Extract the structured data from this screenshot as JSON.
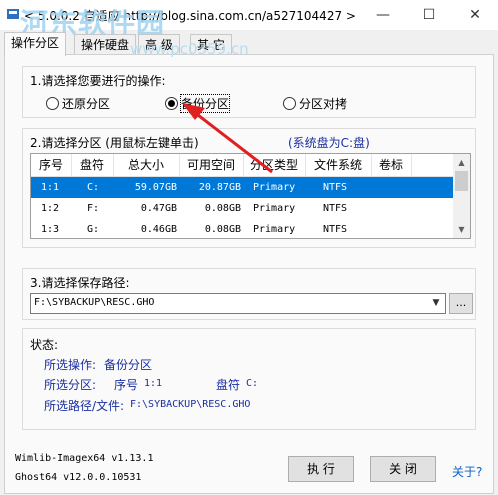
{
  "window": {
    "title": "< 5.0.0.2 自适应 http://blog.sina.com.cn/a527104427 >",
    "minimize_glyph": "—",
    "maximize_glyph": "☐",
    "close_glyph": "✕"
  },
  "watermark": {
    "main": "河东软件园",
    "url": "www.pc0359.cn"
  },
  "tabs": [
    "操作分区",
    "操作硬盘",
    "高 级",
    "其 它"
  ],
  "operation": {
    "label": "1.请选择您要进行的操作:",
    "options": [
      "还原分区",
      "备份分区",
      "分区对拷"
    ],
    "selected": "备份分区"
  },
  "partition": {
    "label": "2.请选择分区 (用鼠标左键单击)",
    "system_disk": "(系统盘为C:盘)",
    "columns": [
      "序号",
      "盘符",
      "总大小",
      "可用空间",
      "分区类型",
      "文件系统",
      "卷标"
    ],
    "rows": [
      {
        "no": "1:1",
        "drive": "C:",
        "total": "59.07GB",
        "free": "20.87GB",
        "type": "Primary",
        "fs": "NTFS",
        "label": ""
      },
      {
        "no": "1:2",
        "drive": "F:",
        "total": "0.47GB",
        "free": "0.08GB",
        "type": "Primary",
        "fs": "NTFS",
        "label": ""
      },
      {
        "no": "1:3",
        "drive": "G:",
        "total": "0.46GB",
        "free": "0.08GB",
        "type": "Primary",
        "fs": "NTFS",
        "label": ""
      }
    ],
    "selected_row": 0
  },
  "save_path": {
    "label": "3.请选择保存路径:",
    "value": "F:\\SYBACKUP\\RESC.GHO",
    "browse_label": "..."
  },
  "status": {
    "title": "状态:",
    "op_label": "所选操作:",
    "op_value": "备份分区",
    "part_label": "所选分区:",
    "part_no_label": "序号",
    "part_no_value": "1:1",
    "drive_label": "盘符",
    "drive_value": "C:",
    "path_label": "所选路径/文件:",
    "path_value": "F:\\SYBACKUP\\RESC.GHO"
  },
  "versions": {
    "wimlib": "Wimlib-Imagex64 v1.13.1",
    "ghost": "Ghost64 v12.0.0.10531"
  },
  "buttons": {
    "execute": "执 行",
    "close": "关 闭",
    "help": "关于?"
  },
  "colors": {
    "selection": "#0078d7",
    "status_text": "#1a2fa0",
    "annotation_arrow": "#e02020",
    "link": "#0b62c4"
  }
}
